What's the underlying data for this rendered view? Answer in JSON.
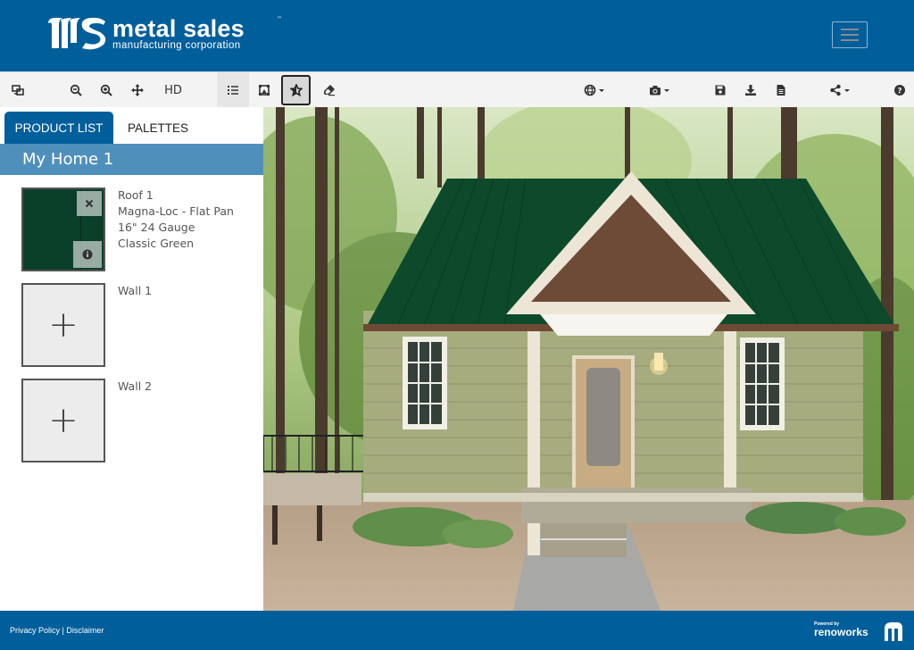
{
  "header": {
    "brand_name": "metal sales",
    "brand_trademark": "™",
    "brand_subtitle": "manufacturing corporation",
    "menu_icon": "hamburger-icon",
    "colors": {
      "primary": "#005e9b",
      "secondary": "#4f8fbb"
    }
  },
  "toolbar": {
    "left": [
      {
        "name": "compare-views",
        "icon": "compare-icon"
      },
      {
        "name": "zoom-out",
        "icon": "zoom-out-icon"
      },
      {
        "name": "zoom-in",
        "icon": "zoom-in-icon"
      },
      {
        "name": "pan",
        "icon": "move-icon"
      },
      {
        "name": "hd",
        "label": "HD"
      },
      {
        "name": "product-list",
        "icon": "list-icon"
      },
      {
        "name": "mask",
        "icon": "mask-icon"
      },
      {
        "name": "favorite",
        "icon": "star-icon",
        "active": true
      },
      {
        "name": "eraser",
        "icon": "eraser-icon"
      }
    ],
    "hd_label": "HD",
    "right": [
      {
        "name": "language",
        "icon": "globe-icon",
        "dropdown": true
      },
      {
        "name": "camera",
        "icon": "camera-icon",
        "dropdown": true
      },
      {
        "name": "save",
        "icon": "save-icon"
      },
      {
        "name": "download",
        "icon": "download-icon"
      },
      {
        "name": "report",
        "icon": "document-icon"
      },
      {
        "name": "share",
        "icon": "share-icon",
        "dropdown": true
      },
      {
        "name": "help",
        "icon": "help-icon"
      }
    ]
  },
  "sidebar": {
    "tabs": [
      {
        "label": "PRODUCT LIST",
        "active": true
      },
      {
        "label": "PALETTES",
        "active": false
      }
    ],
    "project_title": "My Home 1",
    "items": [
      {
        "surface": "Roof 1",
        "product": "Magna-Loc - Flat Pan",
        "spec": "16\" 24 Gauge",
        "color": "Classic Green",
        "swatch_color": "#0a3f2a",
        "assigned": true
      },
      {
        "surface": "Wall 1",
        "assigned": false
      },
      {
        "surface": "Wall 2",
        "assigned": false
      }
    ],
    "add_symbol": "+"
  },
  "canvas": {
    "description": "House visualization with Classic Green metal roof in a forest setting",
    "roof_color": "#0d4a2c"
  },
  "footer": {
    "privacy_label": "Privacy Policy",
    "separator": " | ",
    "disclaimer_label": "Disclaimer",
    "powered_by_label": "Powered by",
    "powered_by_brand": "renoworks"
  }
}
